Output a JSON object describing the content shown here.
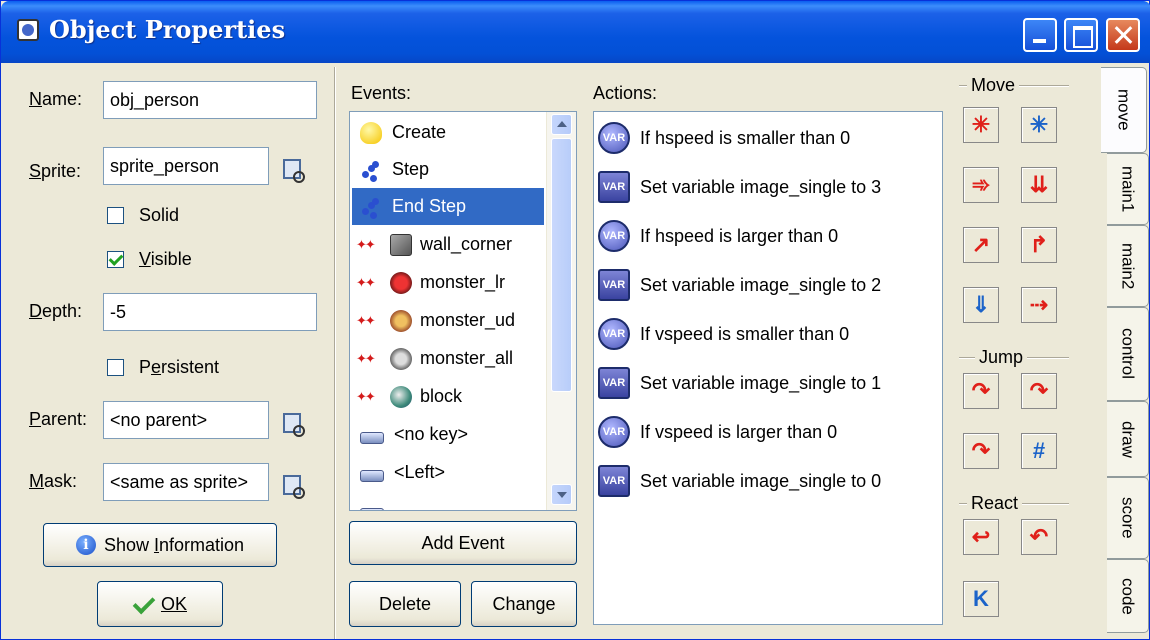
{
  "window": {
    "title": "Object Properties"
  },
  "left": {
    "name_label": "Name:",
    "name_value": "obj_person",
    "sprite_label": "Sprite:",
    "sprite_value": "sprite_person",
    "solid_label": "Solid",
    "solid_checked": false,
    "visible_label": "Visible",
    "visible_checked": true,
    "depth_label": "Depth:",
    "depth_value": "-5",
    "persistent_label": "Persistent",
    "persistent_checked": false,
    "parent_label": "Parent:",
    "parent_value": "<no parent>",
    "mask_label": "Mask:",
    "mask_value": "<same as sprite>",
    "show_info_label": "Show Information",
    "ok_label": "OK"
  },
  "events": {
    "header": "Events:",
    "items": [
      {
        "label": "Create",
        "icon": "lightbulb-icon"
      },
      {
        "label": "Step",
        "icon": "footsteps-icon"
      },
      {
        "label": "End Step",
        "icon": "footsteps-icon",
        "selected": true
      },
      {
        "label": "wall_corner",
        "icon": "collision-icon"
      },
      {
        "label": "monster_lr",
        "icon": "collision-icon"
      },
      {
        "label": "monster_ud",
        "icon": "collision-icon"
      },
      {
        "label": "monster_all",
        "icon": "collision-icon"
      },
      {
        "label": "block",
        "icon": "collision-icon"
      },
      {
        "label": "<no key>",
        "icon": "keyboard-icon"
      },
      {
        "label": "<Left>",
        "icon": "keyboard-icon"
      }
    ],
    "add_event_label": "Add Event",
    "delete_label": "Delete",
    "change_label": "Change"
  },
  "actions": {
    "header": "Actions:",
    "badge_text": "VAR",
    "items": [
      {
        "label": "If hspeed is smaller than 0",
        "kind": "condition"
      },
      {
        "label": "Set variable image_single to 3",
        "kind": "set"
      },
      {
        "label": "If hspeed is larger than 0",
        "kind": "condition"
      },
      {
        "label": "Set variable image_single to 2",
        "kind": "set"
      },
      {
        "label": "If vspeed is smaller than 0",
        "kind": "condition"
      },
      {
        "label": "Set variable image_single to 1",
        "kind": "set"
      },
      {
        "label": "If vspeed is larger than 0",
        "kind": "condition"
      },
      {
        "label": "Set variable image_single to 0",
        "kind": "set"
      }
    ]
  },
  "toolbox": {
    "move_header": "Move",
    "jump_header": "Jump",
    "react_header": "React"
  },
  "tabs": [
    {
      "label": "move",
      "active": true
    },
    {
      "label": "main1"
    },
    {
      "label": "main2"
    },
    {
      "label": "control"
    },
    {
      "label": "draw"
    },
    {
      "label": "score"
    },
    {
      "label": "code"
    }
  ]
}
